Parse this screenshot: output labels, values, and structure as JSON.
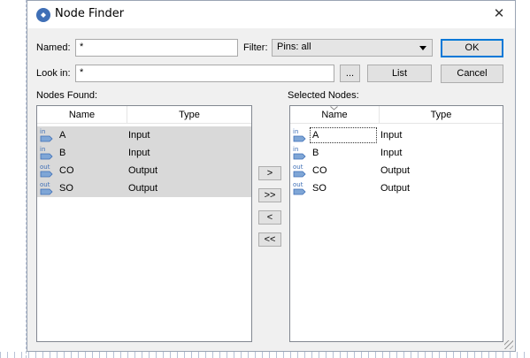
{
  "dialog": {
    "title": "Node Finder",
    "named_label": "Named:",
    "named_value": "*",
    "filter_label": "Filter:",
    "filter_value": "Pins: all",
    "look_in_label": "Look in:",
    "look_in_value": "*",
    "browse_label": "...",
    "list_label": "List",
    "ok_label": "OK",
    "cancel_label": "Cancel",
    "close_glyph": "✕"
  },
  "nodes_found": {
    "label": "Nodes Found:",
    "columns": [
      "Name",
      "Type"
    ],
    "rows": [
      {
        "icon": "in",
        "name": "A",
        "type": "Input"
      },
      {
        "icon": "in",
        "name": "B",
        "type": "Input"
      },
      {
        "icon": "out",
        "name": "CO",
        "type": "Output"
      },
      {
        "icon": "out",
        "name": "SO",
        "type": "Output"
      }
    ]
  },
  "transfer": {
    "add": ">",
    "add_all": ">>",
    "remove": "<",
    "remove_all": "<<"
  },
  "selected_nodes": {
    "label": "Selected Nodes:",
    "columns": [
      "Name",
      "Type"
    ],
    "rows": [
      {
        "icon": "in",
        "name": "A",
        "type": "Input"
      },
      {
        "icon": "in",
        "name": "B",
        "type": "Input"
      },
      {
        "icon": "out",
        "name": "CO",
        "type": "Output"
      },
      {
        "icon": "out",
        "name": "SO",
        "type": "Output"
      }
    ]
  },
  "colors": {
    "selection": "#d9d9d9",
    "accent": "#0078d7",
    "pin_icon": "#3f6fb6"
  }
}
